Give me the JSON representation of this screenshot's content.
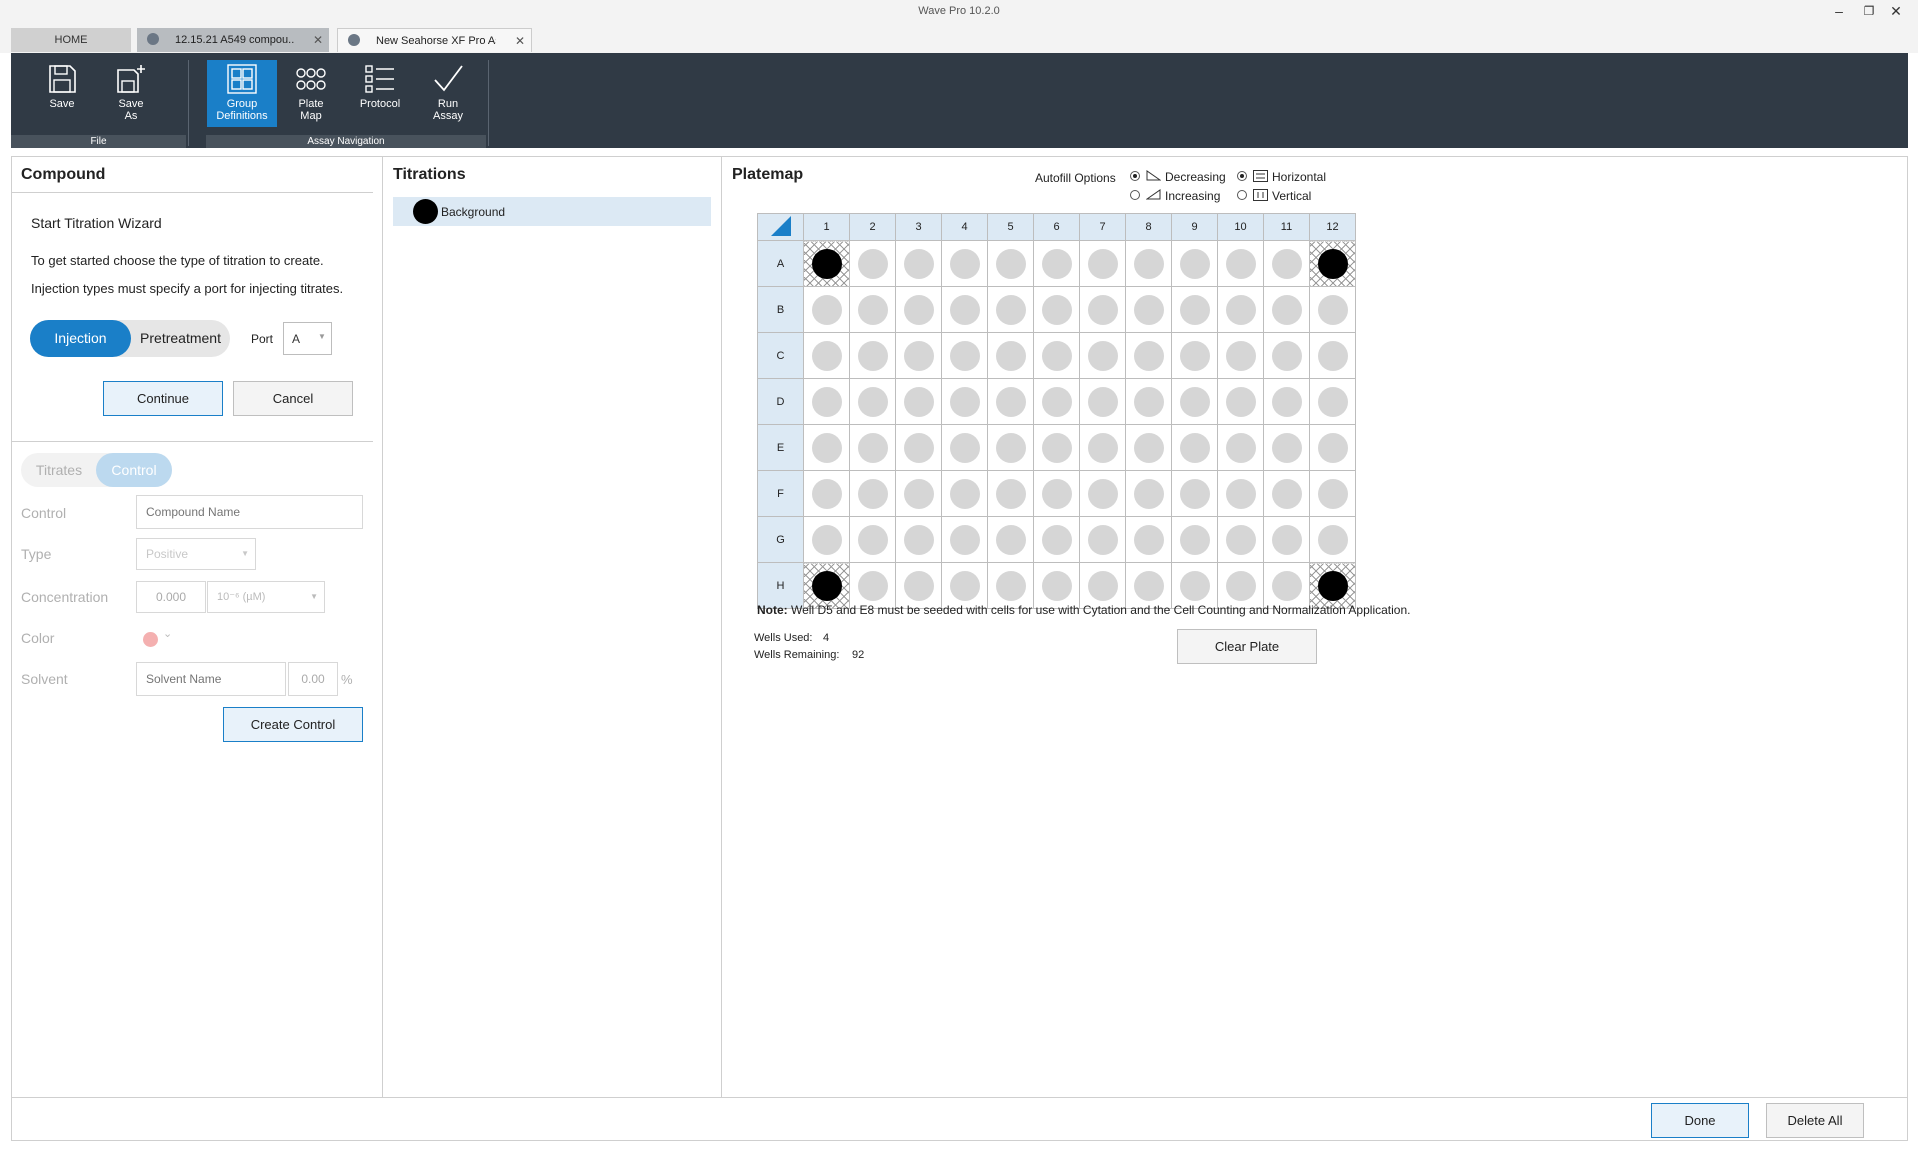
{
  "window": {
    "title": "Wave Pro 10.2.0"
  },
  "tabs": [
    {
      "label": "HOME"
    },
    {
      "label": "12.15.21 A549 compou..."
    },
    {
      "label": "New Seahorse XF Pro As..."
    }
  ],
  "ribbon": {
    "file_group": "File",
    "nav_group": "Assay Navigation",
    "save": "Save",
    "save_as_line1": "Save",
    "save_as_line2": "As",
    "group_def_line1": "Group",
    "group_def_line2": "Definitions",
    "plate_map_line1": "Plate",
    "plate_map_line2": "Map",
    "protocol": "Protocol",
    "run_assay_line1": "Run",
    "run_assay_line2": "Assay"
  },
  "compound": {
    "title": "Compound",
    "wizard_title": "Start Titration Wizard",
    "desc1": "To get started choose the type of titration to create.",
    "desc2": "Injection types must specify a port for injecting titrates.",
    "toggle_injection": "Injection",
    "toggle_pretreatment": "Pretreatment",
    "port_label": "Port",
    "port_value": "A",
    "continue": "Continue",
    "cancel": "Cancel",
    "tab_titrates": "Titrates",
    "tab_control": "Control",
    "control_label": "Control",
    "control_placeholder": "Compound Name",
    "type_label": "Type",
    "type_value": "Positive",
    "concentration_label": "Concentration",
    "concentration_value": "0.000",
    "concentration_unit": "10⁻⁶ (µM)",
    "color_label": "Color",
    "solvent_label": "Solvent",
    "solvent_placeholder": "Solvent Name",
    "solvent_value": "0.00",
    "solvent_unit": "%",
    "create_control": "Create Control"
  },
  "titrations": {
    "title": "Titrations",
    "items": [
      {
        "label": "Background"
      }
    ]
  },
  "platemap": {
    "title": "Platemap",
    "autofill_label": "Autofill Options",
    "opt_decreasing": "Decreasing",
    "opt_increasing": "Increasing",
    "opt_horizontal": "Horizontal",
    "opt_vertical": "Vertical",
    "columns": [
      "1",
      "2",
      "3",
      "4",
      "5",
      "6",
      "7",
      "8",
      "9",
      "10",
      "11",
      "12"
    ],
    "rows": [
      "A",
      "B",
      "C",
      "D",
      "E",
      "F",
      "G",
      "H"
    ],
    "filled_wells": [
      "A1",
      "A12",
      "H1",
      "H12"
    ],
    "note_bold": "Note:",
    "note_text": "Well D5 and E8 must be seeded with cells for use with Cytation and the Cell Counting and Normalization Application.",
    "wells_used_label": "Wells Used:",
    "wells_used_value": "4",
    "wells_remaining_label": "Wells Remaining:",
    "wells_remaining_value": "92",
    "clear_plate": "Clear Plate"
  },
  "footer": {
    "done": "Done",
    "delete_all": "Delete All"
  },
  "colors": {
    "accent": "#1a7fc8",
    "ribbon": "#303a45",
    "well_empty": "#d6d6d6",
    "well_filled": "#000000",
    "header_bg": "#dce9f4"
  }
}
